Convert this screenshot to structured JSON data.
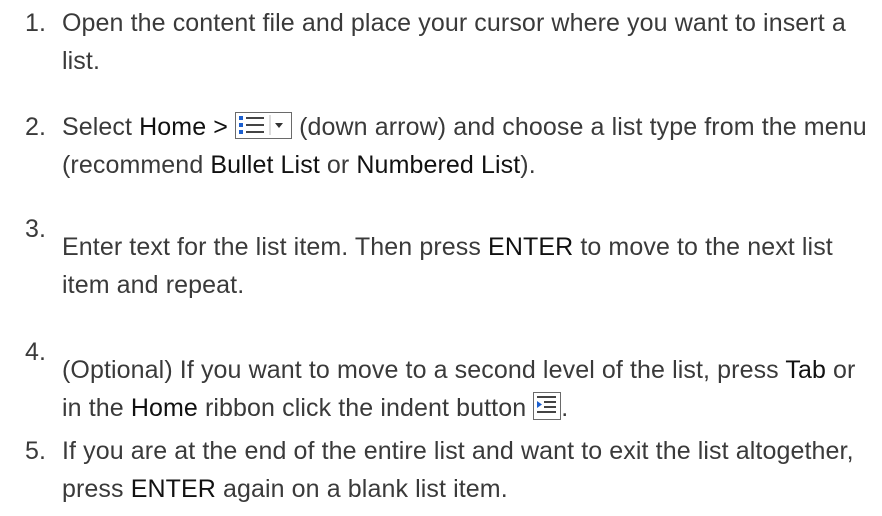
{
  "steps": [
    {
      "number": "1.",
      "text": "Open the content file and place your cursor where you want to insert a list."
    },
    {
      "number": "2.",
      "a": "Select ",
      "home": "Home",
      "gt": " > ",
      "b": " (down arrow) and choose a list type from the menu (recommend ",
      "bullet": "Bullet List",
      "or": " or ",
      "numbered": "Numbered List",
      "end": ")."
    },
    {
      "number": "3.",
      "a": "Enter text for the list item. Then press ",
      "enter": "ENTER",
      "b": " to move to the next list item and repeat."
    },
    {
      "number": "4.",
      "a": "(Optional) If you want to move to a second level of the list, press ",
      "tab": "Tab",
      "b": " or in the ",
      "home": "Home",
      "c": " ribbon click the indent button ",
      "end": "."
    },
    {
      "number": "5.",
      "a": "If you are at the end of the entire list and want to exit the list altogether, press ",
      "enter": "ENTER",
      "b": " again on a blank list item."
    }
  ],
  "icons": {
    "list_button": "bullet-list-dropdown-icon",
    "indent_button": "indent-icon"
  },
  "colors": {
    "text": "#3a3a3a",
    "keyword": "#111111",
    "icon_blue": "#1b5fcf"
  }
}
